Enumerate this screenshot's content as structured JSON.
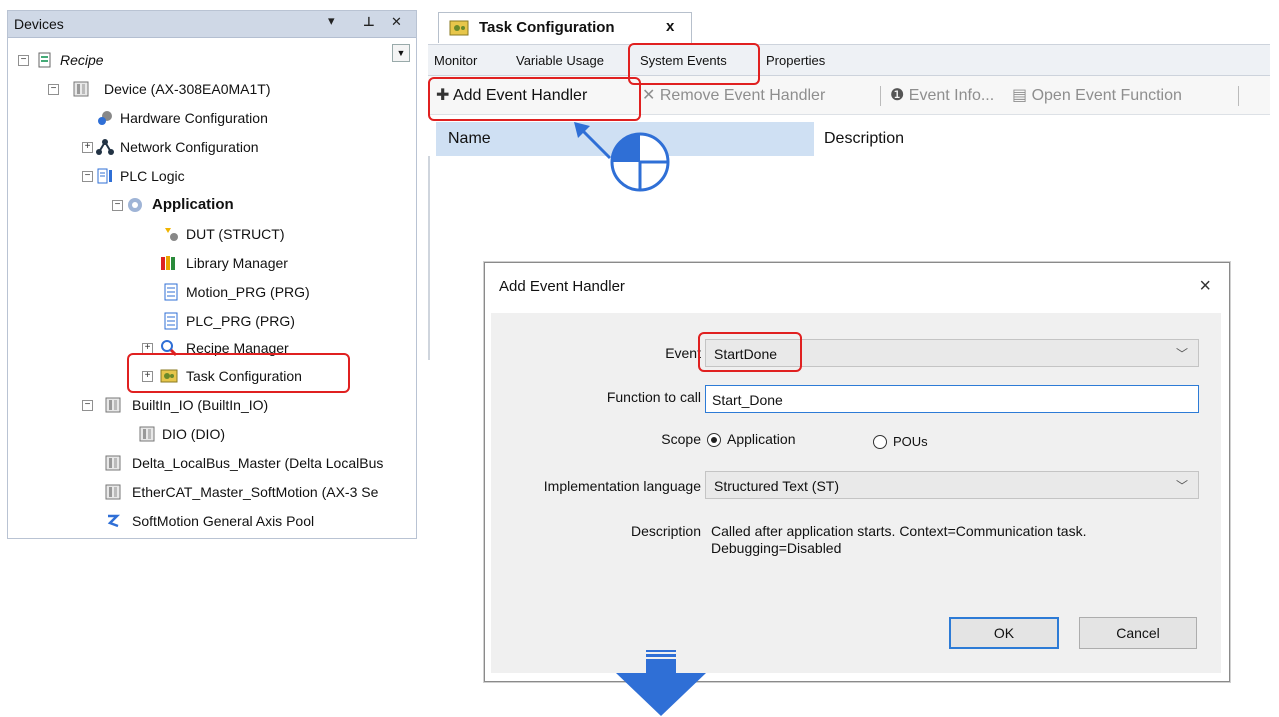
{
  "devices_panel": {
    "title": "Devices",
    "tree": {
      "recipe": "Recipe",
      "device": "Device (AX-308EA0MA1T)",
      "hardware_configuration": "Hardware Configuration",
      "network_configuration": "Network Configuration",
      "plc_logic": "PLC Logic",
      "application": "Application",
      "dut": "DUT (STRUCT)",
      "library_manager": "Library Manager",
      "motion_prg": "Motion_PRG (PRG)",
      "plc_prg": "PLC_PRG (PRG)",
      "recipe_manager": "Recipe Manager",
      "task_configuration": "Task Configuration",
      "builtin_io": "BuiltIn_IO (BuiltIn_IO)",
      "dio": "DIO (DIO)",
      "delta_localbus": "Delta_LocalBus_Master (Delta LocalBus",
      "ethercat_master": "EtherCAT_Master_SoftMotion (AX-3 Se",
      "softmotion_pool": "SoftMotion General Axis Pool"
    }
  },
  "task_panel": {
    "doc_tab": "Task Configuration",
    "close_glyph": "x",
    "tabs": [
      "Monitor",
      "Variable Usage",
      "System Events",
      "Properties"
    ],
    "toolbar": {
      "add": "Add Event Handler",
      "remove": "Remove Event Handler",
      "info": "Event Info...",
      "open": "Open Event Function"
    },
    "columns": {
      "name": "Name",
      "description": "Description"
    }
  },
  "dialog": {
    "title": "Add Event Handler",
    "close_glyph": "×",
    "event_label": "Event",
    "event_value": "StartDone",
    "function_label": "Function to call",
    "function_value": "Start_Done",
    "scope_label": "Scope",
    "scope_application": "Application",
    "scope_pous": "POUs",
    "language_label": "Implementation language",
    "language_value": "Structured Text (ST)",
    "description_label": "Description",
    "description_line1": "Called after application starts. Context=Communication task.",
    "description_line2": "Debugging=Disabled",
    "ok": "OK",
    "cancel": "Cancel"
  },
  "colors": {
    "highlight": "#e02020",
    "arrow": "#2f6fd6",
    "column_header": "#cfe0f3",
    "panel_header": "#cfd8e6"
  }
}
